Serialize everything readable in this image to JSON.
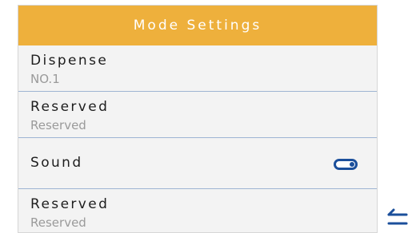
{
  "header": {
    "title": "Mode Settings"
  },
  "rows": [
    {
      "title": "Dispense",
      "value": "NO.1"
    },
    {
      "title": "Reserved",
      "value": "Reserved"
    },
    {
      "title": "Sound",
      "toggle_on": true
    },
    {
      "title": "Reserved",
      "value": "Reserved"
    }
  ],
  "colors": {
    "header_bg": "#eeb03c",
    "accent": "#1b4f9b",
    "row_divider": "#9eb4d3"
  },
  "icons": {
    "toggle": "toggle-switch-icon",
    "back": "back-arrow-icon"
  }
}
